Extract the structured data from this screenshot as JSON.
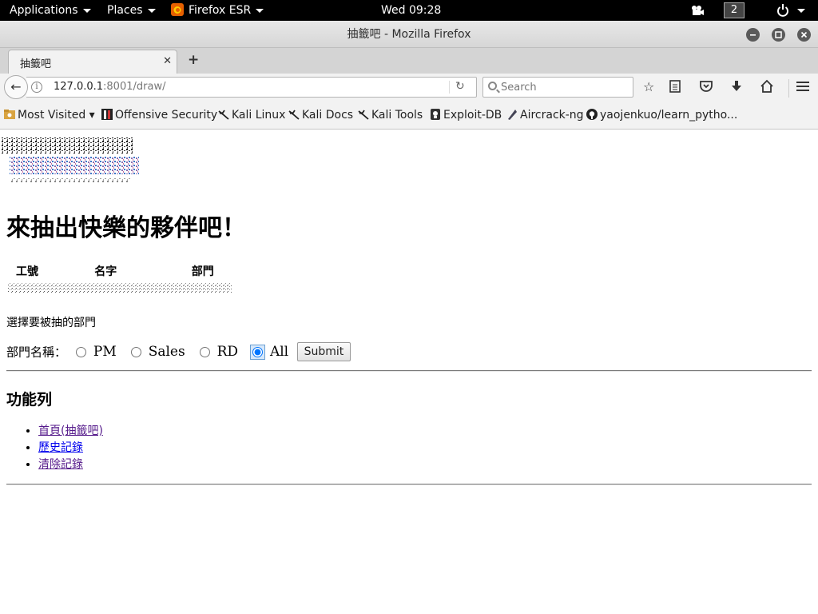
{
  "topbar": {
    "applications": "Applications",
    "places": "Places",
    "app_name": "Firefox ESR",
    "clock": "Wed 09:28",
    "workspace": "2"
  },
  "window": {
    "title": "抽籤吧 - Mozilla Firefox"
  },
  "tabs": [
    {
      "title": "抽籤吧",
      "active": true
    }
  ],
  "navbar": {
    "url_host": "127.0.0.1",
    "url_rest": ":8001/draw/",
    "search_placeholder": "Search"
  },
  "bookmarks": [
    {
      "label": "Most Visited ▾",
      "icon": "star-folder-icon"
    },
    {
      "label": "Offensive Security",
      "icon": "offsec-icon"
    },
    {
      "label": "Kali Linux",
      "icon": "kali-dragon-icon"
    },
    {
      "label": "Kali Docs",
      "icon": "kali-dragon-icon"
    },
    {
      "label": "Kali Tools",
      "icon": "kali-dragon-icon"
    },
    {
      "label": "Exploit-DB",
      "icon": "exploitdb-icon"
    },
    {
      "label": "Aircrack-ng",
      "icon": "aircrack-icon"
    },
    {
      "label": "yaojenkuo/learn_pytho...",
      "icon": "github-icon"
    }
  ],
  "page": {
    "heading": "來抽出快樂的夥伴吧！",
    "table_headers": [
      "工號",
      "名字",
      "部門"
    ],
    "prompt": "選擇要被抽的部門",
    "dept_label": "部門名稱：",
    "departments": [
      {
        "label": "PM",
        "checked": false
      },
      {
        "label": "Sales",
        "checked": false
      },
      {
        "label": "RD",
        "checked": false
      },
      {
        "label": "All",
        "checked": true
      }
    ],
    "submit_label": "Submit",
    "menu_heading": "功能列",
    "menu_items": [
      {
        "label": "首頁(抽籤吧)",
        "visited": true
      },
      {
        "label": "歷史記錄",
        "visited": false
      },
      {
        "label": "清除記錄",
        "visited": true
      }
    ]
  },
  "colors": {
    "panel_bg": "#000000",
    "link_unvisited": "#0000ee",
    "link_visited": "#551a8b"
  }
}
